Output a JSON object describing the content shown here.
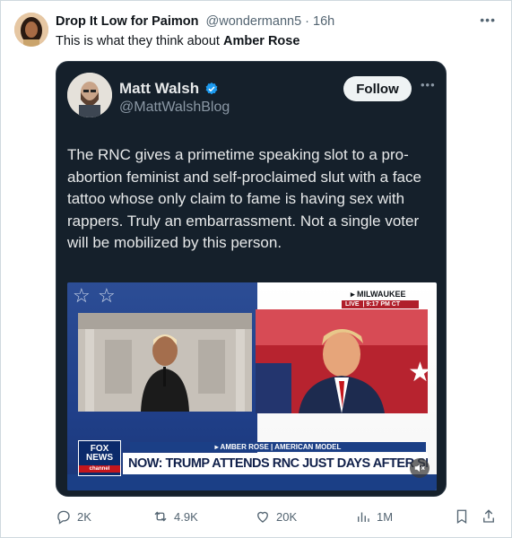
{
  "tweet": {
    "author_name": "Drop It Low for Paimon",
    "author_handle": "@wondermann5",
    "separator": " · ",
    "time": "16h",
    "caption_prefix": "This is what they think about ",
    "caption_bold": "Amber Rose"
  },
  "quoted": {
    "name": "Matt Walsh",
    "handle": "@MattWalshBlog",
    "follow_label": "Follow",
    "text": "The RNC gives a primetime speaking slot to a pro-abortion feminist and self-proclaimed slut with a face tattoo whose only claim to fame is having sex with rappers. Truly an embarrassment. Not a single voter will be mobilized by this person."
  },
  "video": {
    "location": "MILWAUKEE",
    "live_label": "LIVE",
    "live_time": "9:17 PM CT",
    "lower_third_top": "AMBER ROSE | AMERICAN MODEL",
    "headline": "NOW: TRUMP ATTENDS RNC JUST DAYS AFTER SHOOTING",
    "logo_line1": "FOX",
    "logo_line2": "NEWS",
    "logo_line3": "channel"
  },
  "actions": {
    "replies": "2K",
    "reposts": "4.9K",
    "likes": "20K",
    "views": "1M"
  },
  "colors": {
    "embed_bg": "#15202b",
    "follow_bg": "#eff3f4",
    "verified": "#1d9bf0",
    "muted_text": "#536471",
    "fox_blue": "#1b3f86",
    "fox_red": "#c4161c"
  },
  "icons": [
    "more-icon",
    "verified-badge-icon",
    "mute-icon",
    "reply-icon",
    "repost-icon",
    "like-icon",
    "views-icon",
    "bookmark-icon",
    "share-icon"
  ]
}
